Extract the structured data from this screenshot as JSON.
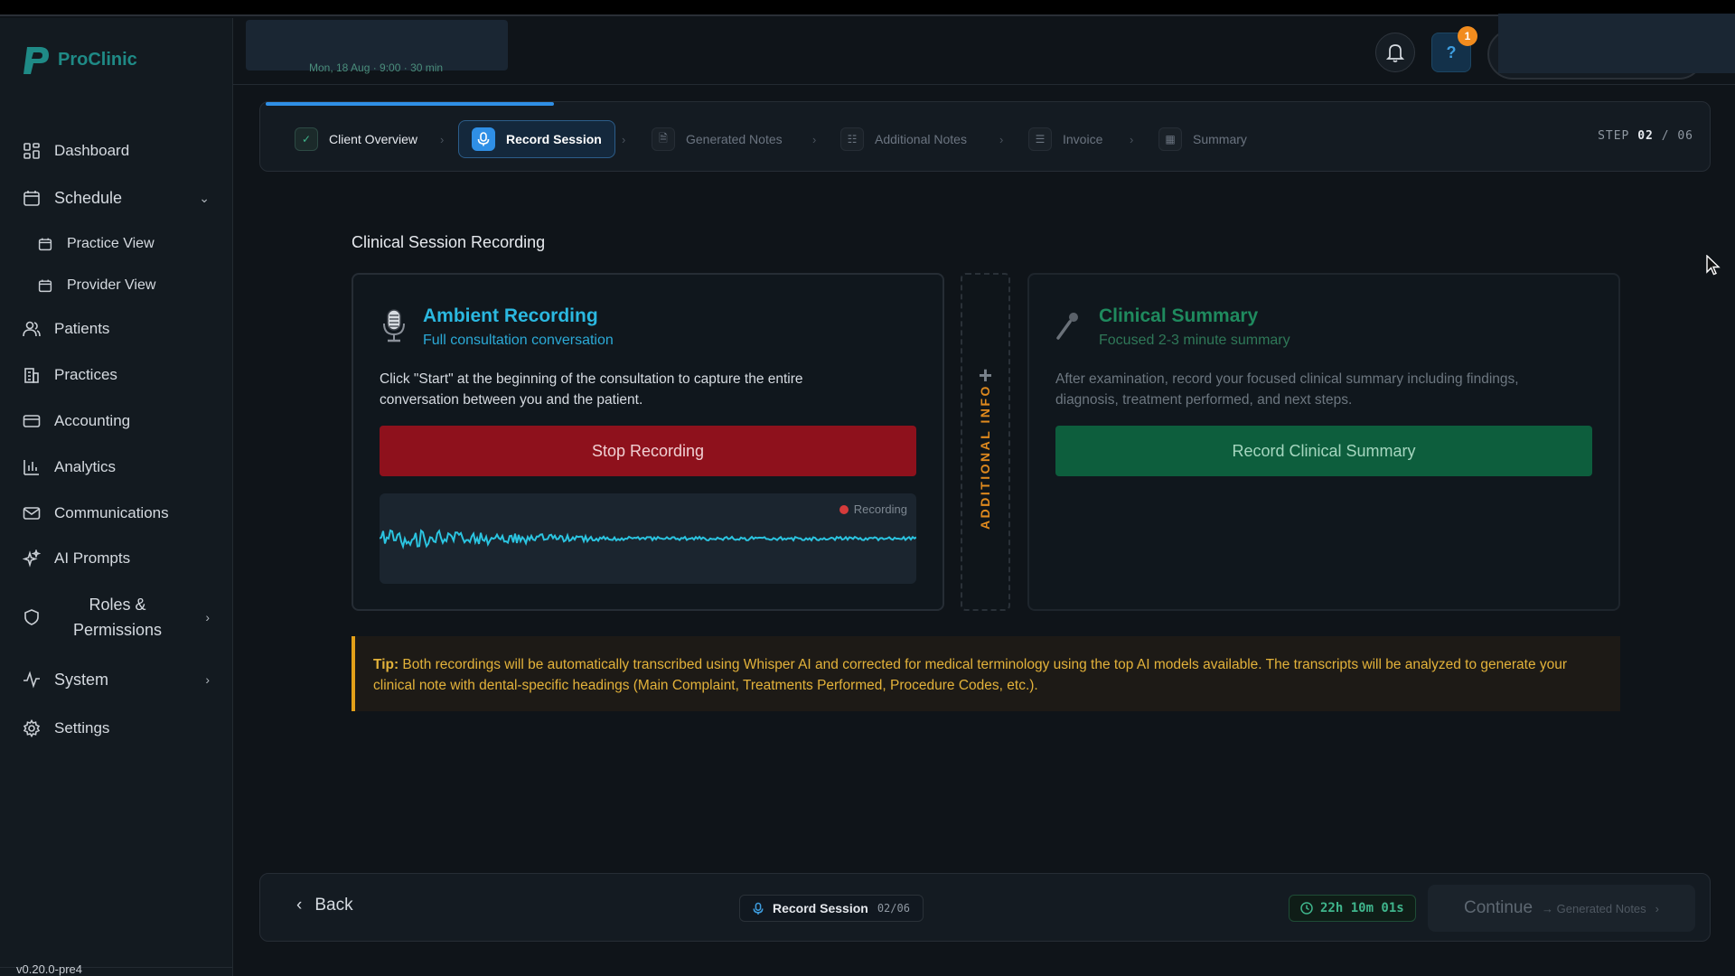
{
  "app": {
    "name": "ProClinic",
    "version": "v0.20.0-pre4"
  },
  "header": {
    "subtitle": "Mon, 18 Aug · 9:00 · 30 min",
    "notification_count": "1",
    "help_symbol": "?"
  },
  "sidebar": {
    "items": [
      {
        "label": "Dashboard"
      },
      {
        "label": "Schedule"
      },
      {
        "label": "Practice View"
      },
      {
        "label": "Provider View"
      },
      {
        "label": "Patients"
      },
      {
        "label": "Practices"
      },
      {
        "label": "Accounting"
      },
      {
        "label": "Analytics"
      },
      {
        "label": "Communications"
      },
      {
        "label": "AI Prompts"
      },
      {
        "label": "Roles &\nPermissions"
      },
      {
        "label": "System"
      },
      {
        "label": "Settings"
      }
    ]
  },
  "stepper": {
    "steps": [
      {
        "label": "Client Overview",
        "state": "done"
      },
      {
        "label": "Record Session",
        "state": "active"
      },
      {
        "label": "Generated Notes",
        "state": "pending"
      },
      {
        "label": "Additional Notes",
        "state": "pending"
      },
      {
        "label": "Invoice",
        "state": "pending"
      },
      {
        "label": "Summary",
        "state": "pending"
      }
    ],
    "counter_prefix": "STEP",
    "current": "02",
    "total": "/ 06",
    "progress": 0.2
  },
  "main": {
    "section_title": "Clinical Session Recording",
    "ambient": {
      "title": "Ambient Recording",
      "subtitle": "Full consultation conversation",
      "description": "Click \"Start\" at the beginning of the consultation to capture the entire conversation between you and the patient.",
      "button": "Stop Recording",
      "status": "Recording"
    },
    "divider_label": "ADDITIONAL INFO",
    "divider_plus": "+",
    "clinical": {
      "title": "Clinical Summary",
      "subtitle": "Focused 2-3 minute summary",
      "description": "After examination, record your focused clinical summary including findings, diagnosis, treatment performed, and next steps.",
      "button": "Record Clinical Summary"
    },
    "tip": {
      "label": "Tip:",
      "text": " Both recordings will be automatically transcribed using Whisper AI and corrected for medical terminology using the top AI models available. The transcripts will be analyzed to generate your clinical note with dental-specific headings (Main Complaint, Treatments Performed, Procedure Codes, etc.)."
    }
  },
  "footer": {
    "back": "Back",
    "step_label": "Record Session",
    "step_count": "02/06",
    "timer": "22h 10m 01s",
    "continue": "Continue",
    "continue_next": "→ Generated Notes"
  },
  "colors": {
    "accent": "#2f8fe6",
    "recording": "#8e111c",
    "clinical": "#0d5e3d",
    "tip": "#e3a019",
    "wave": "#2bc4e0"
  }
}
